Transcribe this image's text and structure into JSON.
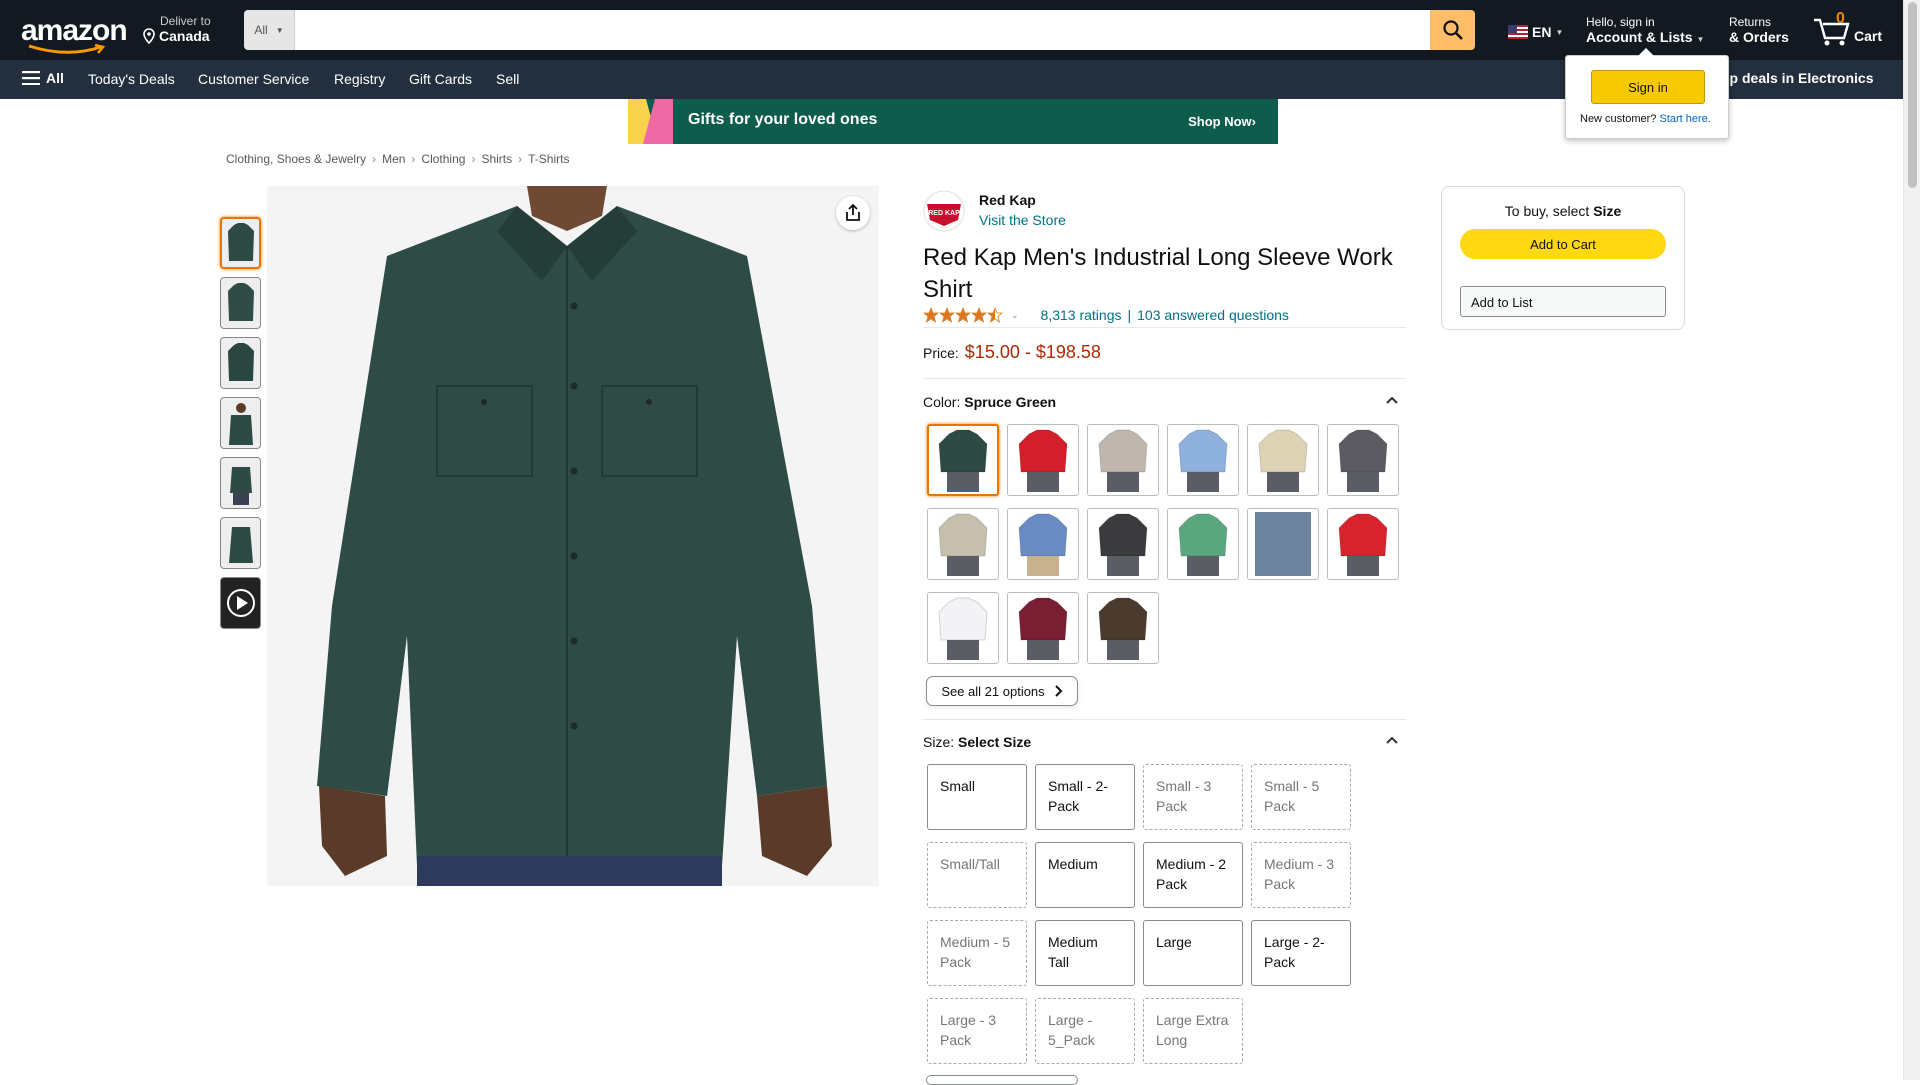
{
  "header": {
    "logo_text": "amazon",
    "deliver_line1": "Deliver to",
    "deliver_line2": "Canada",
    "search_category": "All",
    "search_placeholder": "",
    "lang": "EN",
    "account_line1": "Hello, sign in",
    "account_line2": "Account & Lists",
    "returns_line1": "Returns",
    "returns_line2": "& Orders",
    "cart_count": "0",
    "cart_label": "Cart"
  },
  "nav": {
    "all_label": "All",
    "items": [
      "Today's Deals",
      "Customer Service",
      "Registry",
      "Gift Cards",
      "Sell"
    ],
    "right_text": "op deals in Electronics"
  },
  "banner": {
    "message": "Gifts for your loved ones",
    "cta": "Shop Now›"
  },
  "signin_popup": {
    "button": "Sign in",
    "new_customer": "New customer?",
    "start_here": "Start here."
  },
  "breadcrumb": [
    "Clothing, Shoes & Jewelry",
    "Men",
    "Clothing",
    "Shirts",
    "T-Shirts"
  ],
  "product": {
    "brand": "Red Kap",
    "brand_logo_text": "RED KAP",
    "store_link": "Visit the Store",
    "title": "Red Kap Men's Industrial Long Sleeve Work Shirt",
    "ratings": "8,313 ratings",
    "separator": "|",
    "questions": "103 answered questions",
    "star_rating": 4.5,
    "price_label": "Price:",
    "price_range": "$15.00 - $198.58"
  },
  "color": {
    "label": "Color:",
    "selected": "Spruce Green",
    "swatches": [
      "#2d4a44",
      "#d21f2b",
      "#bfb6ad",
      "#8eb1de",
      "#ddd2b3",
      "#5c5b61",
      "#c7bfae",
      "#6a8ac4",
      "#3b3b3d",
      "#5aa67f",
      "#6d84a1",
      "#d8222c",
      "#f3f3f5",
      "#7a1e34",
      "#4b3a2e"
    ],
    "see_all": "See all 21 options"
  },
  "size": {
    "label": "Size:",
    "selected": "Select Size",
    "options": [
      {
        "label": "Small",
        "available": true
      },
      {
        "label": "Small - 2-Pack",
        "available": true
      },
      {
        "label": "Small - 3 Pack",
        "available": false
      },
      {
        "label": "Small - 5 Pack",
        "available": false
      },
      {
        "label": "Small/Tall",
        "available": false
      },
      {
        "label": "Medium",
        "available": true
      },
      {
        "label": "Medium - 2 Pack",
        "available": true
      },
      {
        "label": "Medium - 3 Pack",
        "available": false
      },
      {
        "label": "Medium - 5 Pack",
        "available": false
      },
      {
        "label": "Medium Tall",
        "available": true
      },
      {
        "label": "Large",
        "available": true
      },
      {
        "label": "Large - 2-Pack",
        "available": true
      },
      {
        "label": "Large - 3 Pack",
        "available": false
      },
      {
        "label": "Large - 5_Pack",
        "available": false
      },
      {
        "label": "Large Extra Long",
        "available": false
      }
    ]
  },
  "buybox": {
    "prompt_prefix": "To buy, select",
    "prompt_bold": "Size",
    "add_to_cart": "Add to Cart",
    "add_to_list": "Add to List"
  },
  "colors": {
    "header_bg": "#131921",
    "nav_bg": "#232f3e",
    "search_button": "#febd69",
    "link": "#007185",
    "price": "#b12704",
    "cart_button": "#ffd814",
    "selected_border": "#e77600"
  }
}
